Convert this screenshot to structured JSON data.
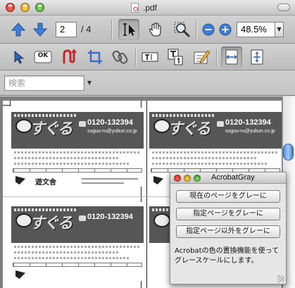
{
  "window": {
    "title": ".pdf"
  },
  "toolbar": {
    "page_number": "2",
    "page_total": "/ 4",
    "zoom": "48.5%",
    "ok_label": "OK"
  },
  "search": {
    "placeholder": "検索"
  },
  "cards": [
    {
      "phone": "0120-132394",
      "email": "suguu-ru@yubun.co.jp",
      "company": "遊文舎"
    },
    {
      "phone": "0120-132394",
      "email": "suguu-ru@yubun.co.jp",
      "company": ""
    },
    {
      "phone": "0120-132394",
      "email": "",
      "company": ""
    },
    {
      "phone": "",
      "email": "",
      "company": ""
    }
  ],
  "palette": {
    "title": "AcrobatGray",
    "buttons": [
      "現在のページをグレーに",
      "指定ページをグレーに",
      "指定ページ以外をグレーに"
    ],
    "description": "Acrobatの色の置換機能を使ってグレースケールにします。"
  },
  "colors": {
    "accent_blue": "#3d7fd6",
    "toolbar": "#c9c9c9",
    "doc_bg": "#7f7f7f"
  }
}
